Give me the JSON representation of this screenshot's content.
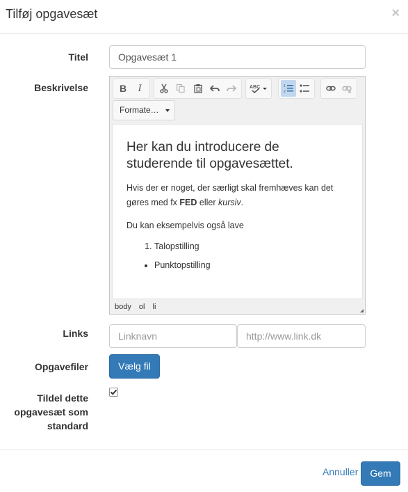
{
  "modal": {
    "title": "Tilføj opgavesæt",
    "close_symbol": "×"
  },
  "form": {
    "title_label": "Titel",
    "title_value": "Opgavesæt 1",
    "description_label": "Beskrivelse",
    "links_label": "Links",
    "link_name_placeholder": "Linknavn",
    "link_url_placeholder": "http://www.link.dk",
    "files_label": "Opgavefiler",
    "choose_file_label": "Vælg fil",
    "default_label_line1": "Tildel dette",
    "default_label_line2": "opgavesæt som",
    "default_label_line3": "standard",
    "default_checked": true
  },
  "editor": {
    "toolbar": {
      "bold": "B",
      "italic": "I",
      "format_select": "Formate…",
      "icons": [
        "bold-icon",
        "italic-icon",
        "cut-icon",
        "copy-icon",
        "paste-icon",
        "undo-icon",
        "redo-icon",
        "spellcheck-icon",
        "numbered-list-icon",
        "bullet-list-icon",
        "link-icon",
        "unlink-icon"
      ]
    },
    "content": {
      "heading": "Her kan du introducere de studerende til opgavesættet.",
      "para1_before": "Hvis der er noget, der særligt skal fremhæves kan det gøres med fx ",
      "para1_bold": "FED",
      "para1_middle": " eller ",
      "para1_italic": "kursiv",
      "para1_end": ".",
      "para2": "Du kan eksempelvis også lave",
      "ordered_item": "Talopstilling",
      "bullet_item": "Punktopstilling"
    },
    "statusbar": [
      "body",
      "ol",
      "li"
    ]
  },
  "footer": {
    "cancel_label": "Annuller",
    "save_label": "Gem"
  },
  "colors": {
    "primary": "#337ab7",
    "active_toolbar": "#c2d7ee"
  }
}
